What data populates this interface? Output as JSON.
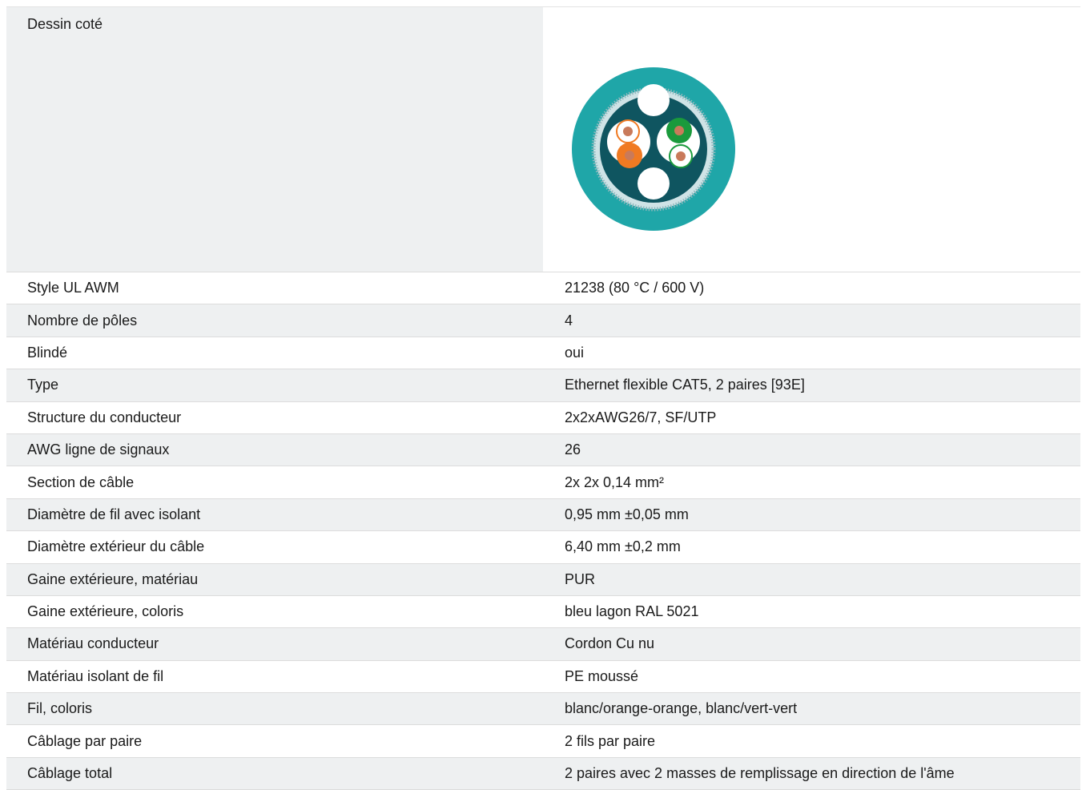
{
  "drawing": {
    "label": "Dessin coté",
    "colors": {
      "sheath": "#1fa6a8",
      "inner": "#0f5560",
      "shield": "#cfe3e6",
      "filler": "#ffffff",
      "orange": "#f07a22",
      "green": "#1a9a3c",
      "copper": "#c97a5a"
    }
  },
  "specs": [
    {
      "label": "Style UL AWM",
      "value": "21238 (80 °C / 600 V)"
    },
    {
      "label": "Nombre de pôles",
      "value": "4"
    },
    {
      "label": "Blindé",
      "value": "oui"
    },
    {
      "label": "Type",
      "value": "Ethernet flexible CAT5, 2 paires [93E]"
    },
    {
      "label": "Structure du conducteur",
      "value": "2x2xAWG26/7, SF/UTP"
    },
    {
      "label": "AWG ligne de signaux",
      "value": "26"
    },
    {
      "label": "Section de câble",
      "value": "2x 2x 0,14 mm²"
    },
    {
      "label": "Diamètre de fil avec isolant",
      "value": "0,95 mm ±0,05 mm"
    },
    {
      "label": "Diamètre extérieur du câble",
      "value": "6,40 mm ±0,2 mm"
    },
    {
      "label": "Gaine extérieure, matériau",
      "value": "PUR"
    },
    {
      "label": "Gaine extérieure, coloris",
      "value": "bleu lagon RAL 5021"
    },
    {
      "label": "Matériau conducteur",
      "value": "Cordon Cu nu"
    },
    {
      "label": "Matériau isolant de fil",
      "value": "PE moussé"
    },
    {
      "label": "Fil, coloris",
      "value": "blanc/orange-orange, blanc/vert-vert"
    },
    {
      "label": "Câblage par paire",
      "value": "2 fils par paire"
    },
    {
      "label": "Câblage total",
      "value": "2 paires avec 2 masses de remplissage en direction de l'âme"
    }
  ]
}
